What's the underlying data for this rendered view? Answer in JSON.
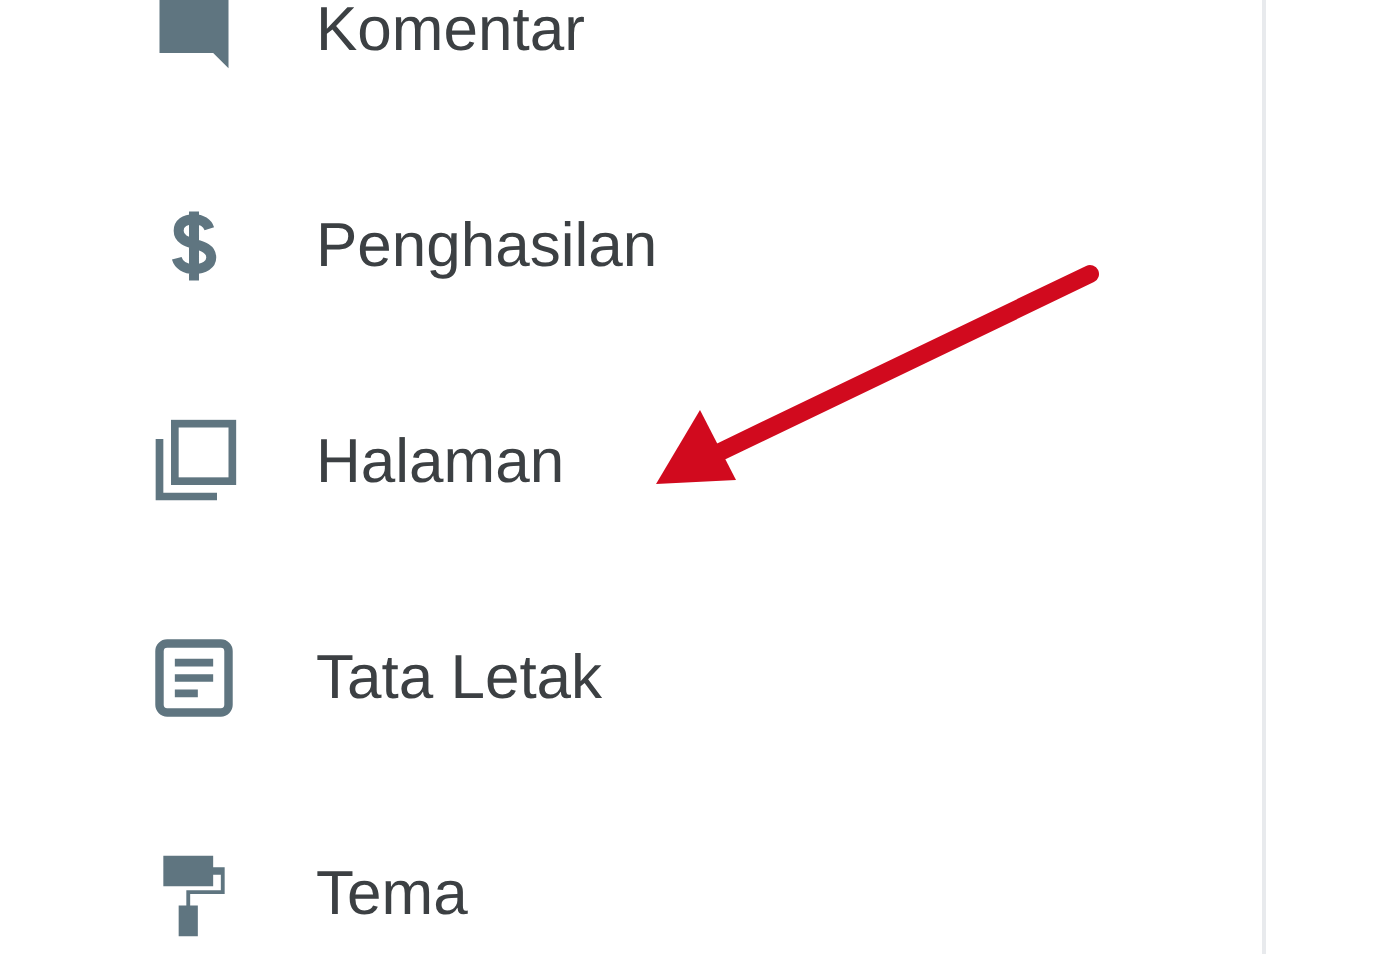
{
  "menu": [
    {
      "label": "Komentar",
      "kind": "comment"
    },
    {
      "label": "Penghasilan",
      "kind": "dollar"
    },
    {
      "label": "Halaman",
      "kind": "pages"
    },
    {
      "label": "Tata Letak",
      "kind": "layout"
    },
    {
      "label": "Tema",
      "kind": "roller"
    }
  ]
}
